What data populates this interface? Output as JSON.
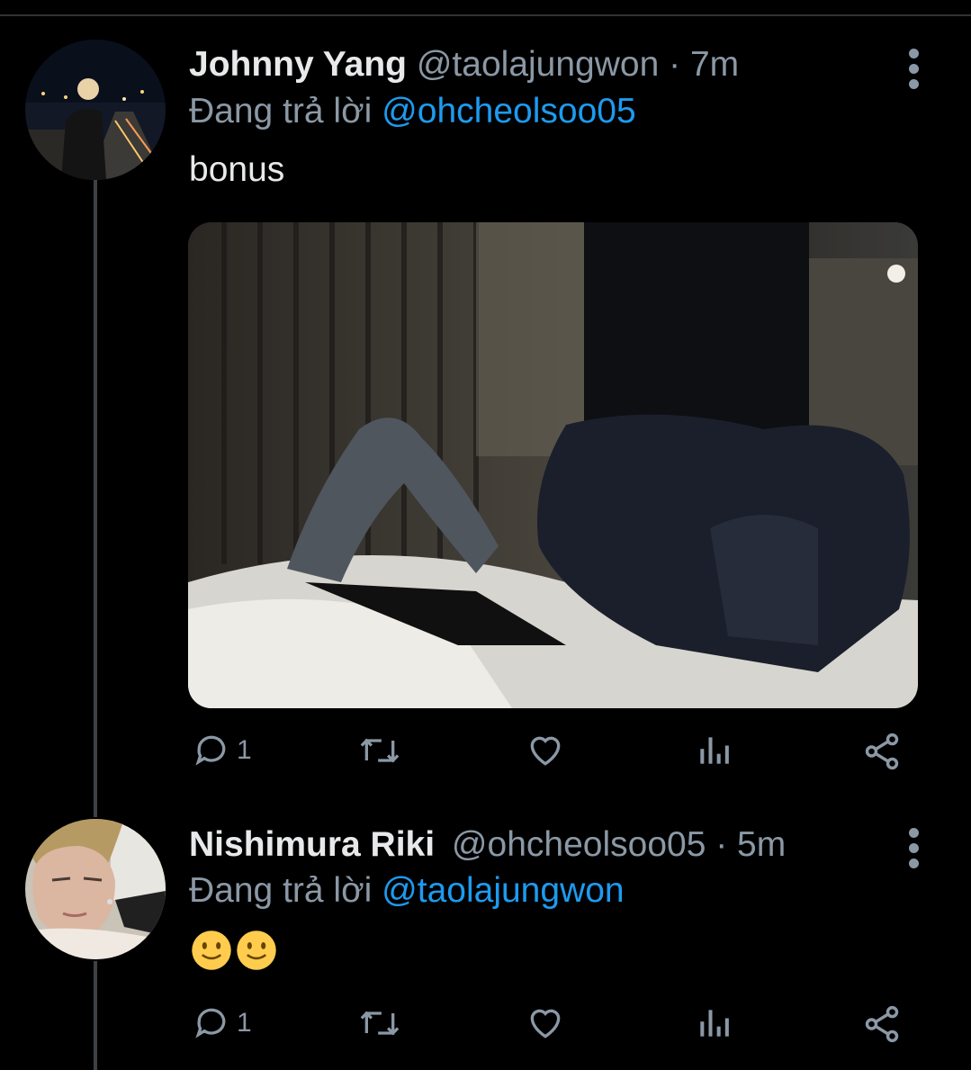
{
  "tweets": [
    {
      "name": "Johnny Yang",
      "handle": "@taolajungwon",
      "time": "· 7m",
      "replying_prefix": "Đang trả lời",
      "replying_to": "@ohcheolsoo05",
      "text": "bonus",
      "reply_count": "1",
      "avatar_icon": "avatar-photo-night-bridge",
      "has_media": true
    },
    {
      "name": "Nishimura Riki",
      "handle": "@ohcheolsoo05",
      "time": "· 5m",
      "replying_prefix": "Đang trả lời",
      "replying_to": "@taolajungwon",
      "text": "🙂🙂",
      "reply_count": "1",
      "avatar_icon": "avatar-photo-blond-face"
    }
  ],
  "icons": {
    "reply": "reply-icon",
    "retweet": "retweet-icon",
    "like": "like-icon",
    "views": "views-icon",
    "share": "share-icon",
    "more": "more-icon"
  },
  "colors": {
    "background": "#000000",
    "mention": "#1d9bf0",
    "muted": "#8b98a5",
    "text": "#e7e9ea"
  }
}
